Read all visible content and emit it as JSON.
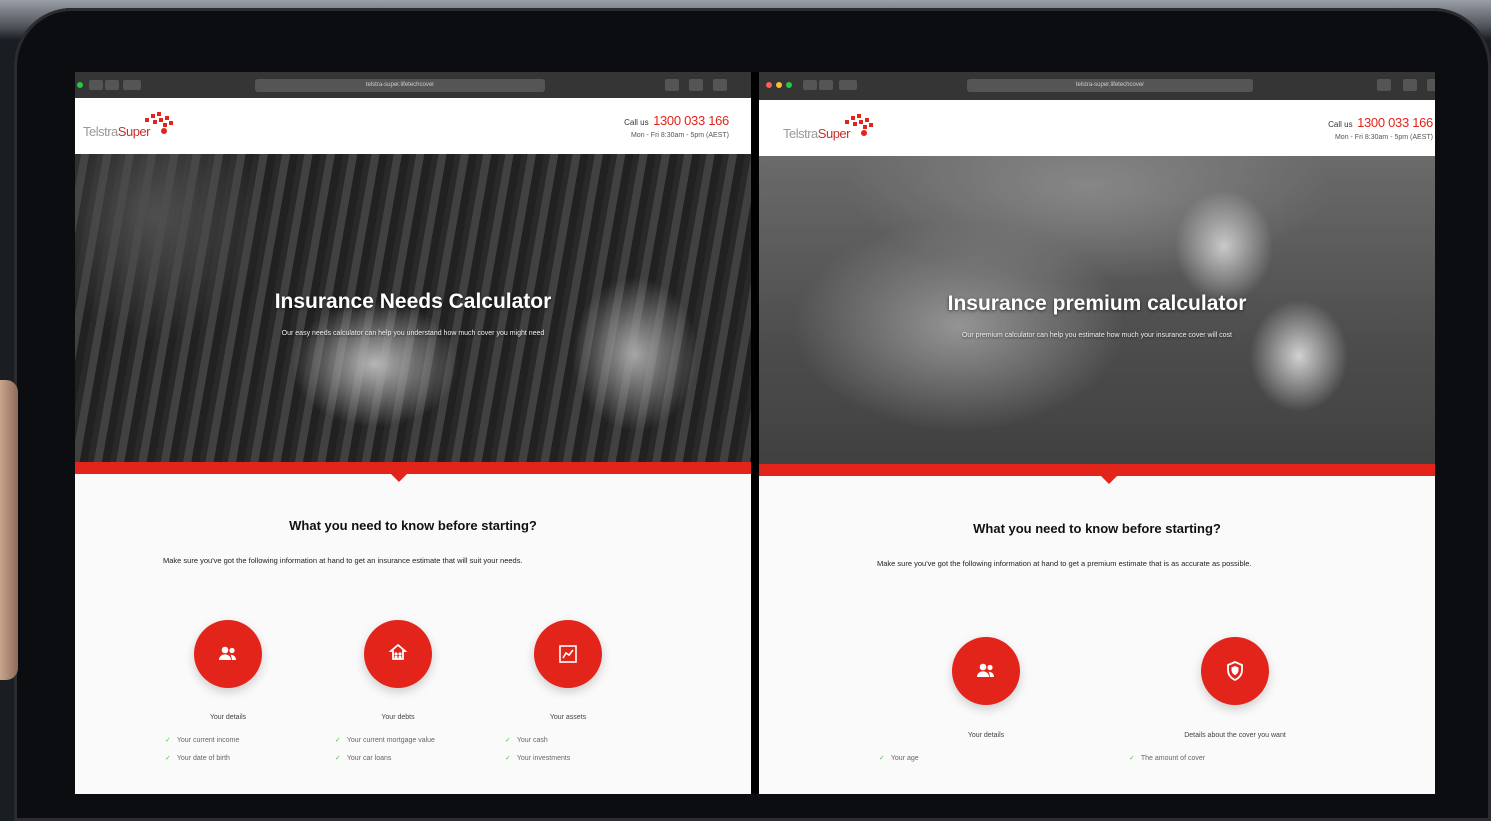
{
  "left_page": {
    "url": "telstra-super.lifetechcover",
    "logo": {
      "brand": "Telstra",
      "brand_accent": "Super"
    },
    "header": {
      "call_label": "Call us",
      "phone": "1300 033 166",
      "hours": "Mon - Fri 8:30am - 5pm (AEST)"
    },
    "hero": {
      "title": "Insurance Needs Calculator",
      "subtitle": "Our easy needs calculator can help you understand how much cover you might need"
    },
    "content": {
      "title": "What you need to know before starting?",
      "description": "Make sure you've got the following information at hand to get an insurance estimate that will suit your needs."
    },
    "cards": [
      {
        "icon": "users-icon",
        "label": "Your details",
        "checks": [
          "Your current income",
          "Your date of birth"
        ]
      },
      {
        "icon": "family-icon",
        "label": "Your debts",
        "checks": [
          "Your current mortgage value",
          "Your car loans"
        ]
      },
      {
        "icon": "chart-icon",
        "label": "Your assets",
        "checks": [
          "Your cash",
          "Your investments"
        ]
      }
    ]
  },
  "right_page": {
    "url": "telstra-super.lifetechcover",
    "logo": {
      "brand": "Telstra",
      "brand_accent": "Super"
    },
    "header": {
      "call_label": "Call us",
      "phone": "1300 033 166",
      "hours": "Mon - Fri 8:30am - 5pm (AEST)"
    },
    "hero": {
      "title": "Insurance premium calculator",
      "subtitle": "Our premium calculator can help you estimate how much your insurance cover will cost"
    },
    "content": {
      "title": "What you need to know before starting?",
      "description": "Make sure you've got the following information at hand to get a premium estimate that is as accurate as possible."
    },
    "cards": [
      {
        "icon": "users-icon",
        "label": "Your details",
        "checks": [
          "Your age"
        ]
      },
      {
        "icon": "shield-icon",
        "label": "Details about the cover you want",
        "checks": [
          "The amount of cover"
        ]
      }
    ]
  },
  "colors": {
    "brand_red": "#e3241b",
    "check_green": "#5cb85c"
  }
}
